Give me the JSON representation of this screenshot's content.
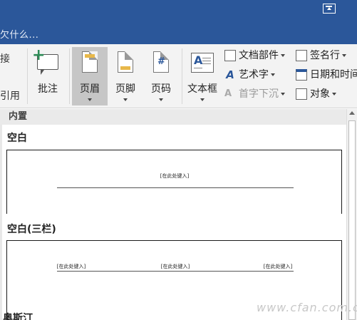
{
  "titlebar": {
    "tell_me": "欠什么..."
  },
  "ribbon": {
    "partial_left_top": "接",
    "partial_left_bottom": "引用",
    "comment": "批注",
    "header": "页眉",
    "footer": "页脚",
    "page_number": "页码",
    "page_number_glyph": "#",
    "textbox": "文本框",
    "quick_parts": "文档部件",
    "wordart": "艺术字",
    "drop_cap": "首字下沉",
    "signature_line": "签名行",
    "date_time": "日期和时间",
    "object": "对象"
  },
  "gallery": {
    "section": "内置",
    "items": [
      {
        "title": "空白",
        "placeholders": [
          "[在此处键入]"
        ]
      },
      {
        "title": "空白(三栏)",
        "placeholders": [
          "[在此处键入]",
          "[在此处键入]",
          "[在此处键入]"
        ]
      },
      {
        "title": "奥斯汀"
      }
    ]
  },
  "watermark": "www.cfan.com.cn",
  "colors": {
    "titlebar": "#2b579a",
    "ribbon": "#f3f3f3",
    "active_button": "#c6c6c6",
    "header_bar": "#e8b84a"
  }
}
